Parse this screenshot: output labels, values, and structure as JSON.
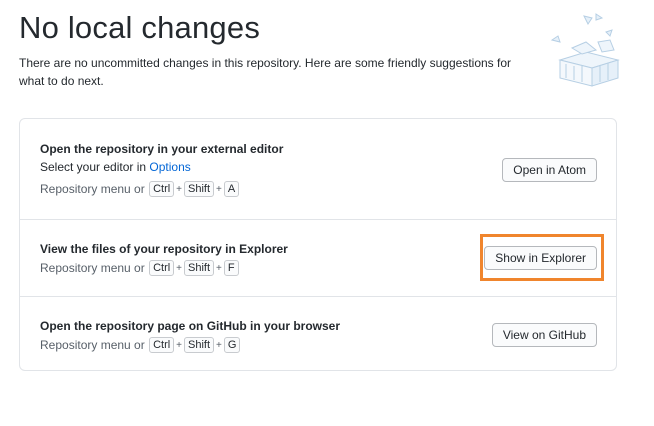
{
  "header": {
    "title": "No local changes",
    "description": "There are no uncommitted changes in this repository. Here are some friendly suggestions for what to do next."
  },
  "suggestions": [
    {
      "title": "Open the repository in your external editor",
      "subtitle_prefix": "Select your editor in ",
      "subtitle_link": "Options",
      "shortcut_prefix": "Repository menu or",
      "keys": [
        "Ctrl",
        "Shift",
        "A"
      ],
      "button": "Open in Atom"
    },
    {
      "title": "View the files of your repository in Explorer",
      "shortcut_prefix": "Repository menu or",
      "keys": [
        "Ctrl",
        "Shift",
        "F"
      ],
      "button": "Show in Explorer"
    },
    {
      "title": "Open the repository page on GitHub in your browser",
      "shortcut_prefix": "Repository menu or",
      "keys": [
        "Ctrl",
        "Shift",
        "G"
      ],
      "button": "View on GitHub"
    }
  ],
  "key_separator": "+",
  "colors": {
    "highlight": "#f0852d",
    "link": "#0366d6",
    "border": "#e1e4e8"
  }
}
